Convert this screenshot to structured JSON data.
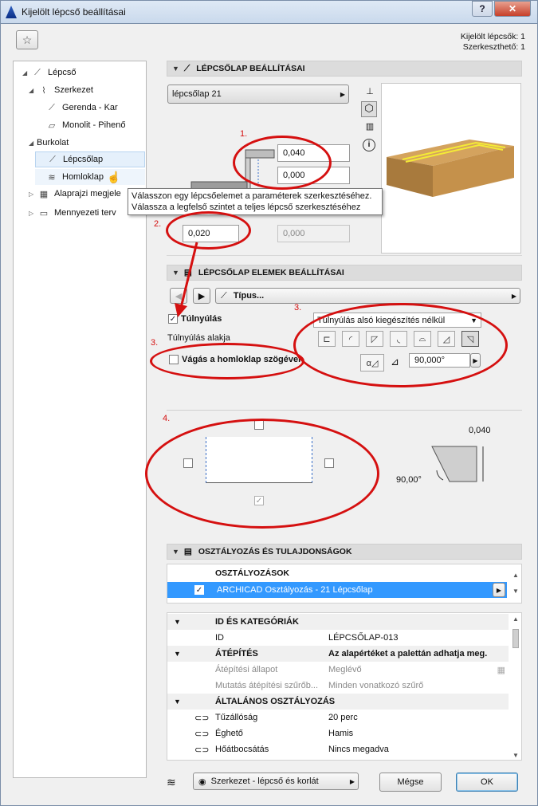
{
  "window": {
    "title": "Kijelölt lépcső beállításai",
    "info_line1": "Kijelölt lépcsők: 1",
    "info_line2": "Szerkeszthető: 1"
  },
  "tree": {
    "items": [
      {
        "label": "Lépcső"
      },
      {
        "label": "Szerkezet"
      },
      {
        "label": "Gerenda - Kar"
      },
      {
        "label": "Monolit - Pihenő"
      },
      {
        "label": "Burkolat"
      },
      {
        "label": "Lépcsőlap"
      },
      {
        "label": "Homloklap"
      },
      {
        "label": "Alaprajzi megjele"
      },
      {
        "label": "Mennyezeti terv"
      }
    ]
  },
  "tooltip": {
    "line1": "Válasszon egy lépcsőelemet a paraméterek szerkesztéséhez.",
    "line2": "Válassza a legfelső szintet a teljes lépcső szerkesztéséhez"
  },
  "section1": {
    "title": "LÉPCSŐLAP BEÁLLÍTÁSAI",
    "dropdown": "lépcsőlap 21",
    "val1": "0,040",
    "val2": "0,000",
    "val3": "0,020",
    "val4": "0,000"
  },
  "section2": {
    "title": "LÉPCSŐLAP ELEMEK BEÁLLÍTÁSAI",
    "type_label": "Típus...",
    "overhang_label": "Túlnyúlás",
    "overhang_shape_label": "Túlnyúlás alakja",
    "cut_label": "Vágás a homloklap szögével",
    "overhang_select": "Túlnyúlás alsó kiegészítés nélkül",
    "angle": "90,000°",
    "preview_height": "0,040",
    "preview_angle": "90,00°"
  },
  "annotations": {
    "a1": "1.",
    "a2": "2.",
    "a3a": "3.",
    "a3b": "3.",
    "a4": "4."
  },
  "section3": {
    "title": "OSZTÁLYOZÁS ÉS TULAJDONSÁGOK",
    "class_header": "OSZTÁLYOZÁSOK",
    "class_row": "ARCHICAD Osztályozás - 21 Lépcsőlap",
    "rows": [
      {
        "type": "header",
        "name": "ID ÉS KATEGÓRIÁK",
        "value": ""
      },
      {
        "type": "row",
        "name": "ID",
        "value": "LÉPCSŐLAP-013"
      },
      {
        "type": "header",
        "name": "ÁTÉPÍTÉS",
        "value": "Az alapértéket a palettán adhatja meg."
      },
      {
        "type": "dis",
        "name": "Átépítési állapot",
        "value": "Meglévő"
      },
      {
        "type": "dis",
        "name": "Mutatás átépítési szűrőb...",
        "value": "Minden vonatkozó szűrő"
      },
      {
        "type": "header",
        "name": "ÁLTALÁNOS OSZTÁLYOZÁS",
        "value": ""
      },
      {
        "type": "link",
        "name": "Tűzállóság",
        "value": "20 perc"
      },
      {
        "type": "link",
        "name": "Éghető",
        "value": "Hamis"
      },
      {
        "type": "link",
        "name": "Hőátbocsátás",
        "value": "Nincs megadva"
      }
    ]
  },
  "footer": {
    "layer": "Szerkezet - lépcső és korlát",
    "cancel": "Mégse",
    "ok": "OK"
  }
}
